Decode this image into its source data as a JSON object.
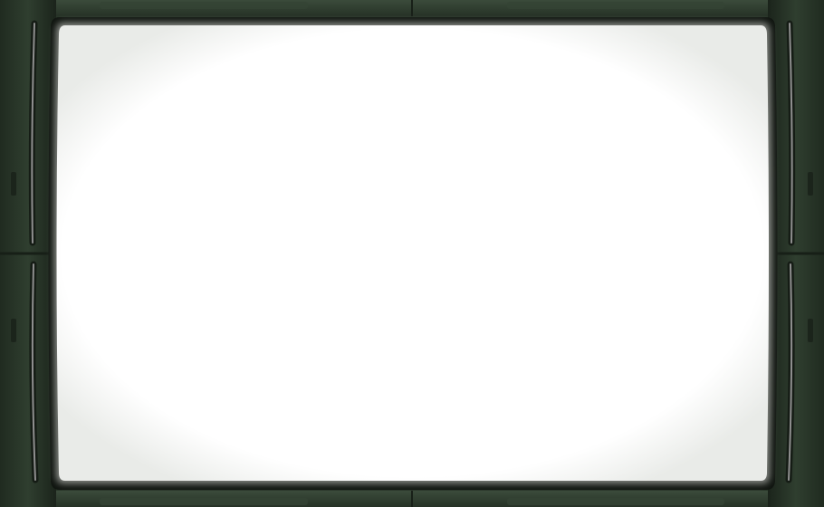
{
  "frame": {
    "style": "military-green beveled monitor bezel",
    "screen_content": "",
    "colors": {
      "bezel_dark": "#1f2a1f",
      "bezel_mid": "#2f3e2f",
      "bezel_light": "#4b5f4b",
      "screen": "#ffffff",
      "slot_light": "#9a9a9a"
    },
    "icons": [
      "left-slot-icon",
      "right-slot-icon",
      "rivet-icon"
    ]
  }
}
